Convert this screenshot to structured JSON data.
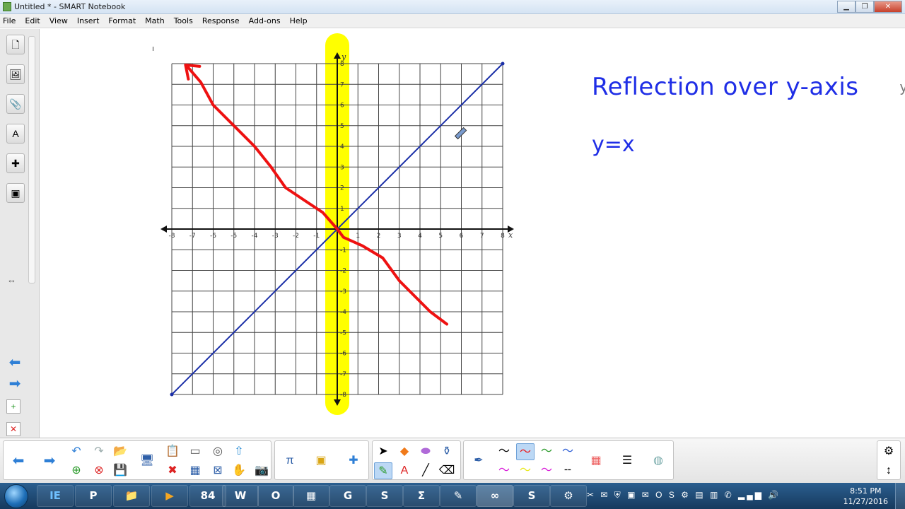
{
  "window": {
    "title": "Untitled * - SMART Notebook",
    "controls": {
      "minimize": "▁",
      "maximize": "❐",
      "close": "✕"
    }
  },
  "menu": [
    "File",
    "Edit",
    "View",
    "Insert",
    "Format",
    "Math",
    "Tools",
    "Response",
    "Add-ons",
    "Help"
  ],
  "canvas": {
    "headline": "Reflection over y-axis",
    "equation": "y=x",
    "edge_mark": "y",
    "cursor_mark": "ı"
  },
  "graph": {
    "x_axis_label": "x",
    "y_axis_label": "y",
    "x_tick_labels": [
      "-8",
      "-7",
      "-6",
      "-5",
      "-4",
      "-3",
      "-2",
      "-1",
      "1",
      "2",
      "3",
      "4",
      "5",
      "6",
      "7",
      "8"
    ],
    "y_tick_labels": [
      "8",
      "7",
      "6",
      "5",
      "4",
      "3",
      "2",
      "1",
      "-1",
      "-2",
      "-3",
      "-4",
      "-5",
      "-6",
      "-7",
      "-8"
    ],
    "colors": {
      "grid": "#444444",
      "diagonal_line": "#1b2fa8",
      "red_curve": "#ee1111",
      "highlighter": "#ffff00"
    }
  },
  "icons": {
    "sidebar": [
      "page-sorter-icon",
      "gallery-icon",
      "attachments-icon",
      "properties-icon",
      "addons-icon",
      "lesson-activity-icon"
    ],
    "toolbar": [
      "previous-page-icon",
      "next-page-icon",
      "undo-icon",
      "redo-icon",
      "open-file-icon",
      "add-page-icon",
      "delete-page-icon",
      "save-icon",
      "display-screen-icon",
      "paste-icon",
      "delete-icon",
      "screen-shade-icon",
      "table-icon",
      "full-screen-icon",
      "document-camera-icon",
      "capture-icon",
      "select-icon",
      "shapes-icon",
      "eraser-icon",
      "fill-icon",
      "pen-icon",
      "text-icon",
      "line-icon",
      "eraser-tool-icon",
      "pen-style-icon",
      "color-palette-icon",
      "properties-menu-icon",
      "extra-tool-icon",
      "settings-icon",
      "move-toolbar-icon"
    ]
  },
  "taskbar": {
    "apps": [
      "IE",
      "P",
      "📁",
      "▶",
      "84",
      "W",
      "O",
      "▦",
      "G",
      "S",
      "Σ",
      "✎",
      "∞",
      "S",
      "⚙"
    ],
    "tray_icons": "✂ ✉ ⛨ ▣ ✉ O S ⚙ ▤ ▥ ✆ ▂▄▆ 🔊",
    "time": "8:51 PM",
    "date": "11/27/2016"
  }
}
